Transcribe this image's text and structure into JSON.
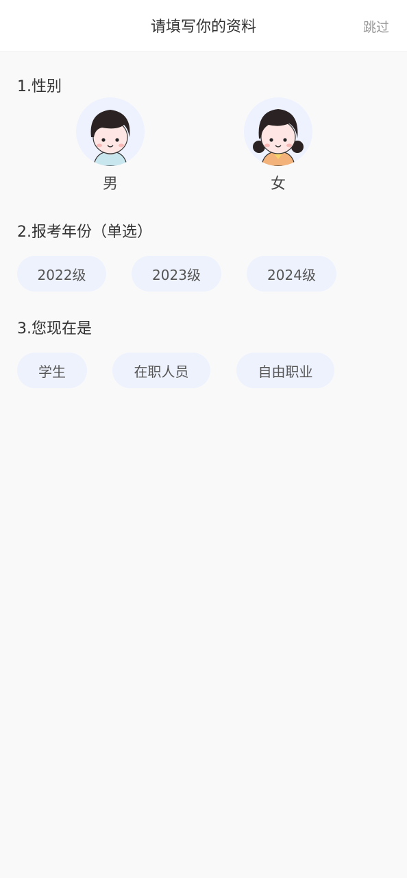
{
  "header": {
    "title": "请填写你的资料",
    "skip_label": "跳过"
  },
  "gender_section": {
    "title": "1.性别",
    "options": [
      {
        "label": "男",
        "icon": "boy-avatar-icon"
      },
      {
        "label": "女",
        "icon": "girl-avatar-icon"
      }
    ]
  },
  "year_section": {
    "title": "2.报考年份（单选）",
    "options": [
      "2022级",
      "2023级",
      "2024级"
    ]
  },
  "status_section": {
    "title": "3.您现在是",
    "options": [
      "学生",
      "在职人员",
      "自由职业"
    ]
  },
  "colors": {
    "page_bg": "#f9f9f9",
    "chip_bg": "#eef2fd",
    "avatar_bg": "#eef2fe",
    "skip_text": "#999999"
  }
}
